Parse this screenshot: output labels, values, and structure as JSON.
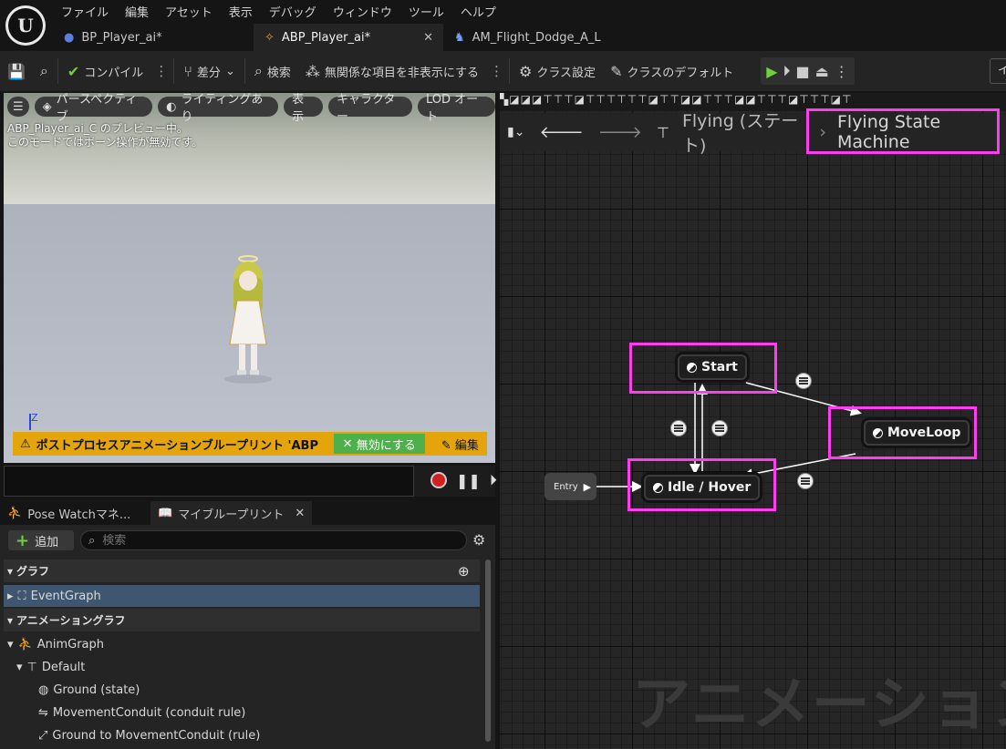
{
  "menu": [
    "ファイル",
    "編集",
    "アセット",
    "表示",
    "デバッグ",
    "ウィンドウ",
    "ツール",
    "ヘルプ"
  ],
  "tabs": [
    {
      "label": "BP_Player_ai*",
      "icon": "person-icon"
    },
    {
      "label": "ABP_Player_ai*",
      "icon": "running-icon",
      "active": true
    },
    {
      "label": "AM_Flight_Dodge_A_L",
      "icon": "montage-icon"
    }
  ],
  "toolbar": {
    "compile": "コンパイル",
    "diff": "差分",
    "search": "検索",
    "hide_unrelated": "無関係な項目を非表示にする",
    "class_settings": "クラス設定",
    "class_defaults": "クラスのデフォルト",
    "right_cut": "イ"
  },
  "viewport": {
    "perspective": "パースペクティブ",
    "lighting": "ライティングあり",
    "show": "表示",
    "character": "キャラクター",
    "lod": "LOD オート",
    "info_line1": "ABP_Player_ai_C のプレビュー中。",
    "info_line2": "このモードではボーン操作が無効です。",
    "axis_label": "Z",
    "warning": "ポストプロセスアニメーションブループリント 'ABP",
    "disable": "無効にする",
    "edit": "編集"
  },
  "panel": {
    "tab_pose_watch": "Pose Watchマネ...",
    "tab_my_blueprint": "マイブループリント",
    "add": "追加",
    "search_placeholder": "検索",
    "section_graph": "グラフ",
    "event_graph": "EventGraph",
    "section_anim_graph": "アニメーショングラフ",
    "anim_graph": "AnimGraph",
    "default": "Default",
    "ground_state": "Ground (state)",
    "movement_conduit": "MovementConduit (conduit rule)",
    "ground_to_conduit": "Ground to MovementConduit (rule)"
  },
  "graph": {
    "tabs_strip": "▚◪◪◪⊤⊤⊤◪⊤⊤⊤⊤⊤⊤◪⊤⊤◪◪⊤⊤⊤◪◪⊤⊤⊤◪⊤⊤⊤◪⊤",
    "crumb1": "Flying (ステート)",
    "crumb2": "Flying State Machine",
    "nodes": {
      "start": "Start",
      "moveloop": "MoveLoop",
      "idle": "Idle / Hover",
      "entry": "Entry"
    },
    "watermark": "アニメーション",
    "highlight_color": "#ff3cf0"
  }
}
